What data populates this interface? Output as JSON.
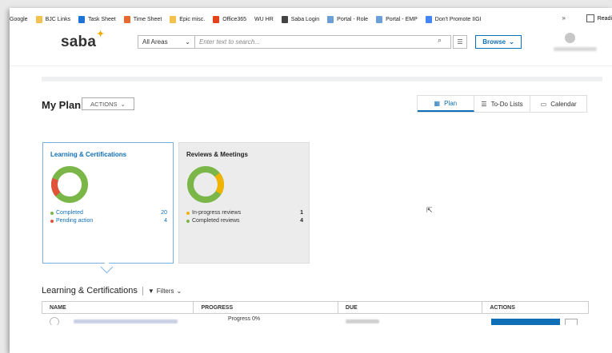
{
  "bookmarks": [
    {
      "label": "Google",
      "icon": "google-icon",
      "color": ""
    },
    {
      "label": "BJC Links",
      "icon": "folder-icon",
      "color": "#f3c24e"
    },
    {
      "label": "Task Sheet",
      "icon": "c-icon",
      "color": "#1e73d6"
    },
    {
      "label": "Time Sheet",
      "icon": "clock-icon",
      "color": "#e8692e"
    },
    {
      "label": "Epic misc.",
      "icon": "folder-icon",
      "color": "#f3c24e"
    },
    {
      "label": "Office365",
      "icon": "office-icon",
      "color": "#e3421b"
    },
    {
      "label": "WU HR",
      "icon": "wu-icon",
      "color": ""
    },
    {
      "label": "Saba Login",
      "icon": "globe-icon",
      "color": "#444444"
    },
    {
      "label": "Portal - Role",
      "icon": "doc-icon",
      "color": "#6a9fd8"
    },
    {
      "label": "Portal - EMP",
      "icon": "doc-icon",
      "color": "#6a9fd8"
    },
    {
      "label": "Don't Promote IIGI",
      "icon": "google-g-icon",
      "color": "#4285f4"
    }
  ],
  "bookmarks_more": "»",
  "reading_list": "Readi",
  "header": {
    "logo": "saba",
    "scope": "All Areas",
    "search_placeholder": "Enter text to search...",
    "browse_label": "Browse"
  },
  "page": {
    "title": "My Plan",
    "actions_label": "ACTIONS"
  },
  "tabs": [
    {
      "label": "Plan",
      "icon": "grid-icon",
      "active": true
    },
    {
      "label": "To-Do Lists",
      "icon": "list-icon",
      "active": false
    },
    {
      "label": "Calendar",
      "icon": "calendar-icon",
      "active": false
    }
  ],
  "cards": {
    "learning": {
      "title": "Learning & Certifications",
      "items": [
        {
          "label": "Completed",
          "count": "20",
          "color": "#7ab648"
        },
        {
          "label": "Pending action",
          "count": "4",
          "color": "#e0533a"
        }
      ]
    },
    "reviews": {
      "title": "Reviews & Meetings",
      "items": [
        {
          "label": "In-progress reviews",
          "count": "1",
          "color": "#f0b400"
        },
        {
          "label": "Completed reviews",
          "count": "4",
          "color": "#7ab648"
        }
      ]
    }
  },
  "section": {
    "title": "Learning & Certifications",
    "filters_label": "Filters"
  },
  "table": {
    "columns": [
      "NAME",
      "PROGRESS",
      "DUE",
      "ACTIONS"
    ],
    "rows": [
      {
        "progress": "Progress 0%"
      }
    ]
  },
  "colors": {
    "accent": "#0f6fb6",
    "completed": "#7ab648",
    "pending": "#e0533a",
    "in_progress": "#f0b400"
  }
}
